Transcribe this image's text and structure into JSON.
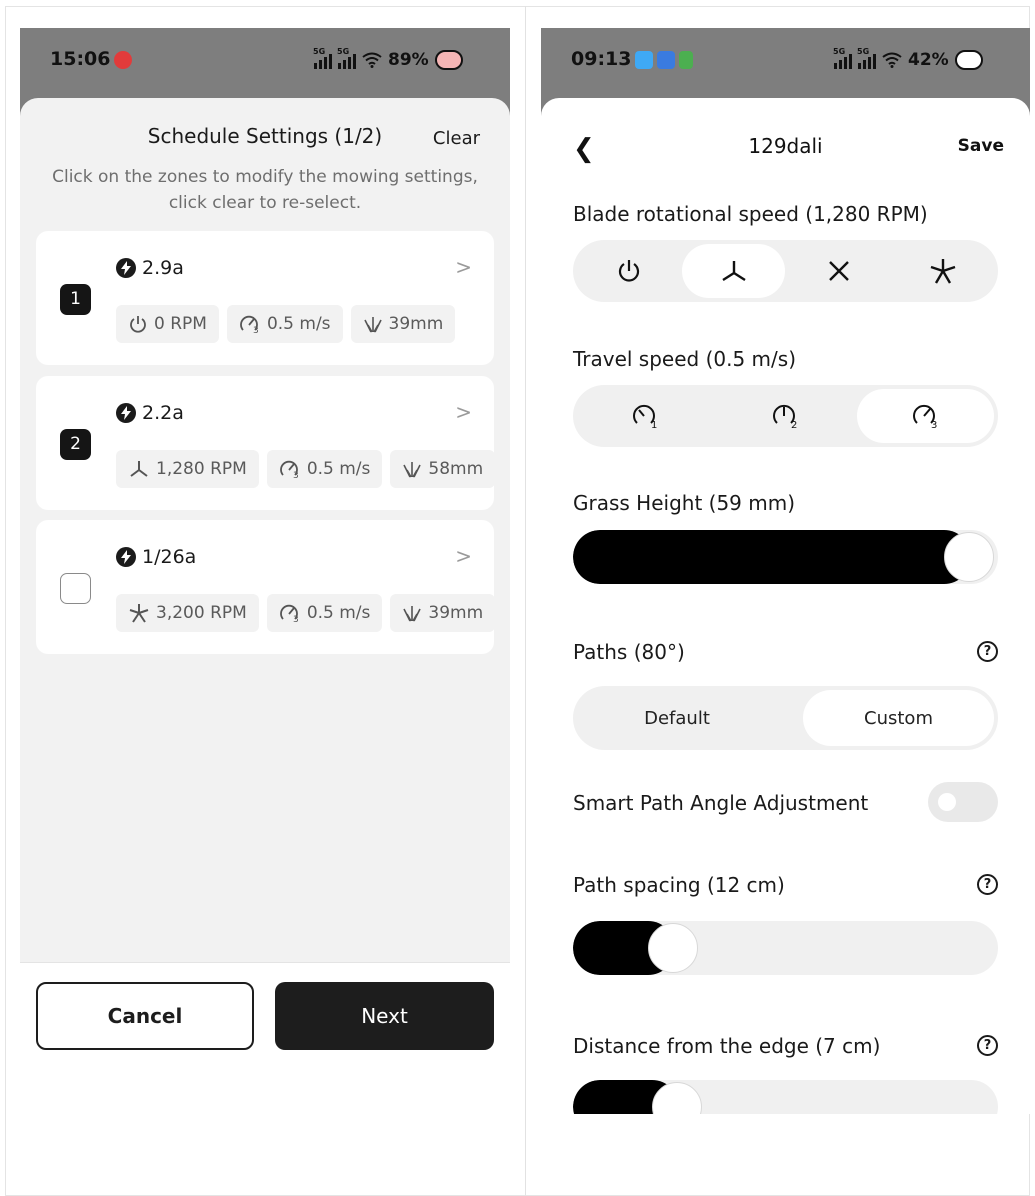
{
  "left_phone": {
    "status": {
      "time": "15:06",
      "battery": "89%"
    },
    "title": "Schedule Settings (1/2)",
    "clear_label": "Clear",
    "subtitle": "Click on the zones to modify the mowing settings, click clear to re-select.",
    "zones": [
      {
        "badge": "1",
        "name": "2.9a",
        "rpm": "0 RPM",
        "speed": "0.5 m/s",
        "height": "39mm",
        "blade_icon": "power-icon"
      },
      {
        "badge": "2",
        "name": "2.2a",
        "rpm": "1,280 RPM",
        "speed": "0.5 m/s",
        "height": "58mm",
        "blade_icon": "blade-3-icon"
      },
      {
        "badge": "",
        "name": "1/26a",
        "rpm": "3,200 RPM",
        "speed": "0.5 m/s",
        "height": "39mm",
        "blade_icon": "blade-5-icon"
      }
    ],
    "cancel_label": "Cancel",
    "next_label": "Next"
  },
  "right_phone": {
    "status": {
      "time": "09:13",
      "battery": "42%"
    },
    "back_icon": "back-chevron-icon",
    "title": "129dali",
    "save_label": "Save",
    "blade_speed_label": "Blade rotational speed (1,280 RPM)",
    "blade_selected_index": 1,
    "travel_speed_label": "Travel speed (0.5 m/s)",
    "travel_selected_index": 2,
    "grass_height_label": "Grass Height (59 mm)",
    "grass_height_fraction": 1.0,
    "paths_label": "Paths (80°)",
    "paths_options": [
      "Default",
      "Custom"
    ],
    "paths_selected": "Custom",
    "smart_path_label": "Smart Path Angle Adjustment",
    "smart_path_on": false,
    "path_spacing_label": "Path spacing (12 cm)",
    "path_spacing_fraction": 0.2,
    "edge_distance_label": "Distance from the edge (7 cm)",
    "edge_distance_fraction": 0.21
  }
}
